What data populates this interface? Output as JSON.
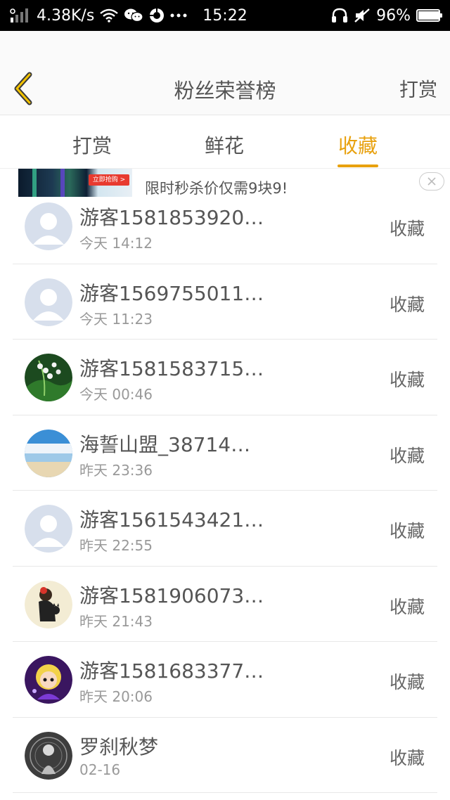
{
  "status_bar": {
    "network_speed": "4.38K/s",
    "time": "15:22",
    "battery": "96%",
    "battery_level": 0.96,
    "icons": [
      "signal-icon",
      "wifi-icon",
      "wechat-icon",
      "app-icon",
      "more-icon",
      "headset-icon",
      "mute-icon",
      "battery-icon"
    ]
  },
  "header": {
    "title": "粉丝荣誉榜",
    "action": "打赏",
    "accent_color": "#e8a10e"
  },
  "tabs": [
    {
      "label": "打赏"
    },
    {
      "label": "鲜花"
    },
    {
      "label": "收藏",
      "active": true
    }
  ],
  "ad": {
    "text": "限时秒杀价仅需9块9!",
    "cta": "立即抢购 >"
  },
  "list": [
    {
      "name": "游客1581853920…",
      "time": "今天 14:12",
      "action": "收藏",
      "avatar": "default"
    },
    {
      "name": "游客1569755011…",
      "time": "今天 11:23",
      "action": "收藏",
      "avatar": "default"
    },
    {
      "name": "游客1581583715…",
      "time": "今天 00:46",
      "action": "收藏",
      "avatar": "lily"
    },
    {
      "name": "海誓山盟_38714…",
      "time": "昨天 23:36",
      "action": "收藏",
      "avatar": "beach"
    },
    {
      "name": "游客1561543421…",
      "time": "昨天 22:55",
      "action": "收藏",
      "avatar": "default"
    },
    {
      "name": "游客1581906073…",
      "time": "昨天 21:43",
      "action": "收藏",
      "avatar": "cat-girl"
    },
    {
      "name": "游客1581683377…",
      "time": "昨天 20:06",
      "action": "收藏",
      "avatar": "blonde-doll"
    },
    {
      "name": "罗刹秋梦",
      "time": "02-16",
      "action": "收藏",
      "avatar": "dark-fantasy"
    }
  ]
}
